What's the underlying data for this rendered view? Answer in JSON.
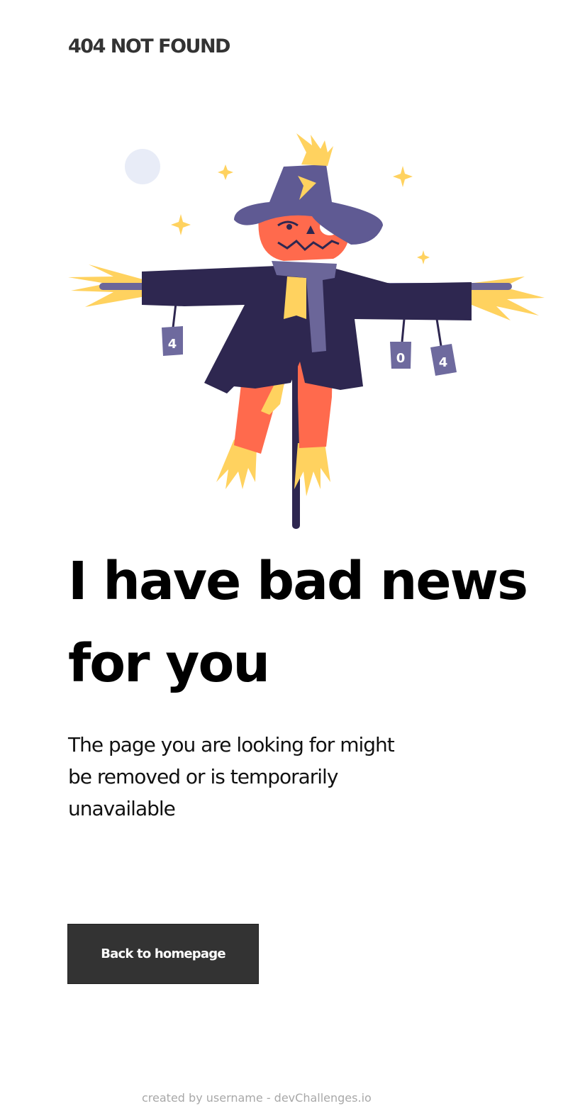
{
  "header": {
    "brand": "404 NOT FOUND"
  },
  "illustration": {
    "can_labels": [
      "4",
      "0",
      "4"
    ],
    "colors": {
      "moon": "#E8ECF7",
      "star": "#FFD25F",
      "straw": "#FFD25F",
      "hat": "#5F5A93",
      "face": "#FF6A4D",
      "coat": "#2E2750",
      "scarf": "#6B6699",
      "pants": "#FF6A4D",
      "pole": "#2E2750",
      "can": "#6E6A9E"
    }
  },
  "main": {
    "headline": "I have bad news for you",
    "description": "The page you are looking for might be removed or is temporarily unavailable",
    "button_label": "Back to homepage"
  },
  "footer": {
    "text": "created by username - devChallenges.io"
  },
  "colors": {
    "button_bg": "#333333",
    "button_text": "#FFFFFF",
    "footer_text": "#A8A8A8"
  }
}
